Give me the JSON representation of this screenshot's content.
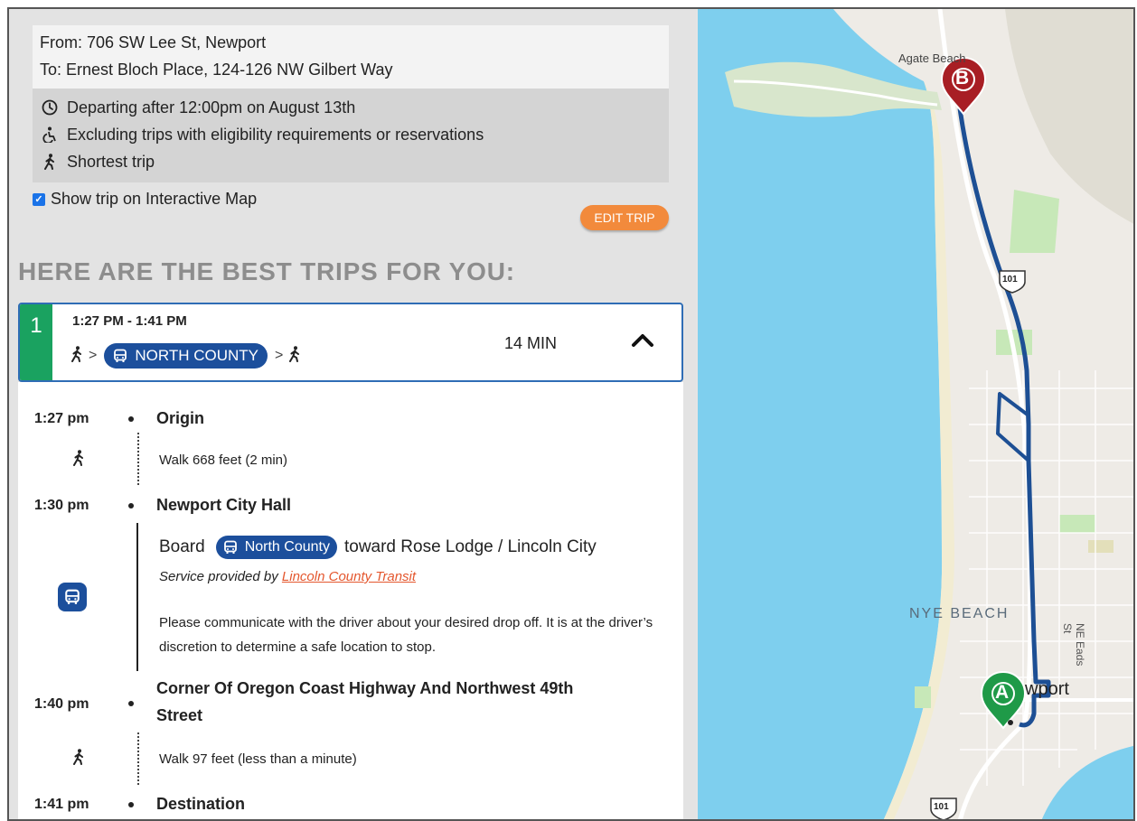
{
  "trip": {
    "from": "From: 706 SW Lee St, Newport",
    "to": "To: Ernest Bloch Place, 124-126 NW Gilbert Way",
    "prefs": [
      {
        "icon": "clock-icon",
        "text": "Departing after 12:00pm on August 13th"
      },
      {
        "icon": "wheelchair-icon",
        "text": "Excluding trips with eligibility requirements or reservations"
      },
      {
        "icon": "walk-icon",
        "text": "Shortest trip"
      }
    ]
  },
  "show_map": {
    "label": "Show trip on Interactive Map",
    "checked": true
  },
  "edit_button": "EDIT TRIP",
  "heading": "HERE ARE THE BEST TRIPS FOR YOU:",
  "itinerary": {
    "number": "1",
    "time_range": "1:27 PM - 1:41 PM",
    "route_label": "NORTH COUNTY",
    "separator": ">",
    "duration": "14 MIN",
    "accent": "#1aa260",
    "route_color": "#1c4f9c"
  },
  "steps": {
    "origin": {
      "time": "1:27 pm",
      "name": "Origin"
    },
    "walk1": "Walk 668 feet (2 min)",
    "boarding": {
      "time": "1:30 pm",
      "name": "Newport City Hall"
    },
    "board_word": "Board",
    "route_name": "North County",
    "toward": "toward Rose Lodge / Lincoln City",
    "service_prefix": "Service provided by",
    "agency": "Lincoln County Transit",
    "note": "Please communicate with the driver about your desired drop off. It is at the driver’s discretion to determine a safe location to stop.",
    "alight": {
      "time": "1:40 pm",
      "name_line1": "Corner Of Oregon Coast Highway And Northwest 49th",
      "name_line2": "Street"
    },
    "walk2": "Walk 97 feet (less than a minute)",
    "destination": {
      "time": "1:41 pm",
      "name": "Destination"
    }
  },
  "map": {
    "labels": {
      "agate": "Agate Beach",
      "nye": "NYE BEACH",
      "newport": "wport",
      "eads": "NE Eads St",
      "hwy": "101"
    },
    "marker_a": "A",
    "marker_b": "B",
    "colors": {
      "water": "#7ecfee",
      "land": "#eeebe6",
      "route": "#1d4f94",
      "marker_a": "#1f9a48",
      "marker_b": "#a81e24"
    }
  }
}
